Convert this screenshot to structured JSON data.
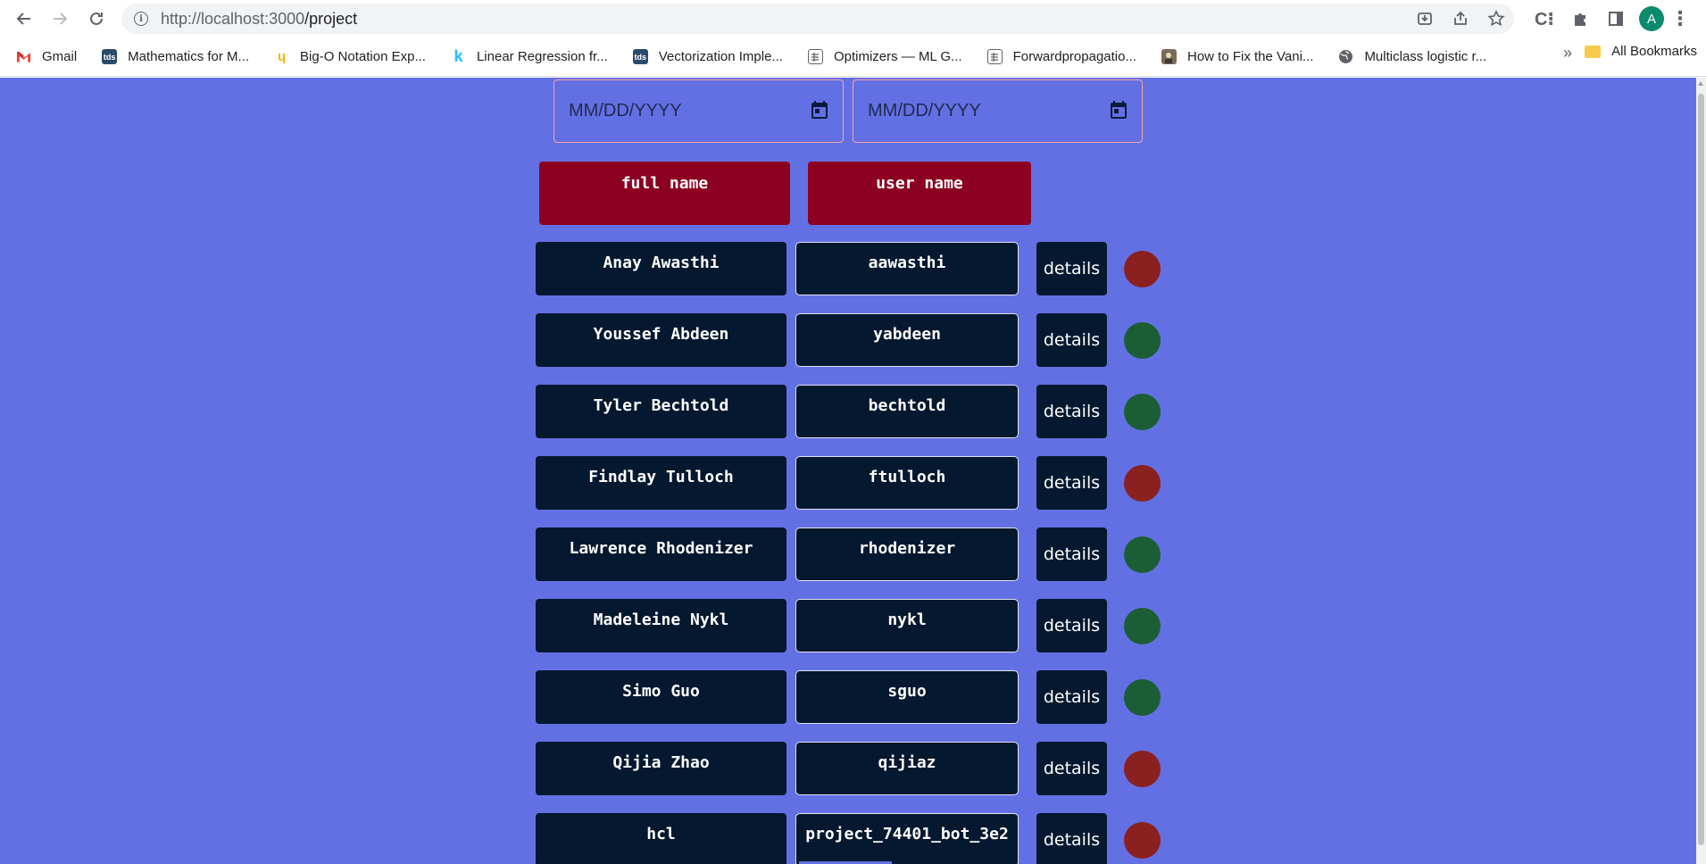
{
  "browser": {
    "url_host": "http://localhost:3000",
    "url_path": "/project",
    "profile_initial": "A",
    "bookmarks": [
      {
        "label": "Gmail",
        "icon": "gmail-icon"
      },
      {
        "label": "Mathematics for M...",
        "icon": "tds-icon"
      },
      {
        "label": "Big-O Notation Exp...",
        "icon": "bigo-icon"
      },
      {
        "label": "Linear Regression fr...",
        "icon": "k-icon"
      },
      {
        "label": "Vectorization Imple...",
        "icon": "tds-icon"
      },
      {
        "label": "Optimizers — ML G...",
        "icon": "doc-icon"
      },
      {
        "label": "Forwardpropagatio...",
        "icon": "doc-icon"
      },
      {
        "label": "How to Fix the Vani...",
        "icon": "person-icon"
      },
      {
        "label": "Multiclass logistic r...",
        "icon": "globe-icon"
      }
    ],
    "more_label": "»",
    "all_bookmarks": "All Bookmarks"
  },
  "filters": {
    "start_date_placeholder": "MM/DD/YYYY",
    "end_date_placeholder": "MM/DD/YYYY"
  },
  "headers": {
    "full_name": "full name",
    "user_name": "user name"
  },
  "details_label": "details",
  "colors": {
    "page_bg": "#6370e4",
    "header_bg": "#8c0022",
    "cell_bg": "#04182f",
    "status_active": "#1b5e35",
    "status_inactive": "#8b2020"
  },
  "users": [
    {
      "full_name": "Anay Awasthi",
      "user_name": "aawasthi",
      "status": "inactive"
    },
    {
      "full_name": "Youssef Abdeen",
      "user_name": "yabdeen",
      "status": "active"
    },
    {
      "full_name": "Tyler Bechtold",
      "user_name": "bechtold",
      "status": "active"
    },
    {
      "full_name": "Findlay Tulloch",
      "user_name": "ftulloch",
      "status": "inactive"
    },
    {
      "full_name": "Lawrence Rhodenizer",
      "user_name": "rhodenizer",
      "status": "active"
    },
    {
      "full_name": "Madeleine Nykl",
      "user_name": "nykl",
      "status": "active"
    },
    {
      "full_name": "Simo Guo",
      "user_name": "sguo",
      "status": "active"
    },
    {
      "full_name": "Qijia Zhao",
      "user_name": "qijiaz",
      "status": "inactive"
    },
    {
      "full_name": "hcl",
      "user_name": "project_74401_bot_3e2",
      "status": "inactive"
    }
  ]
}
